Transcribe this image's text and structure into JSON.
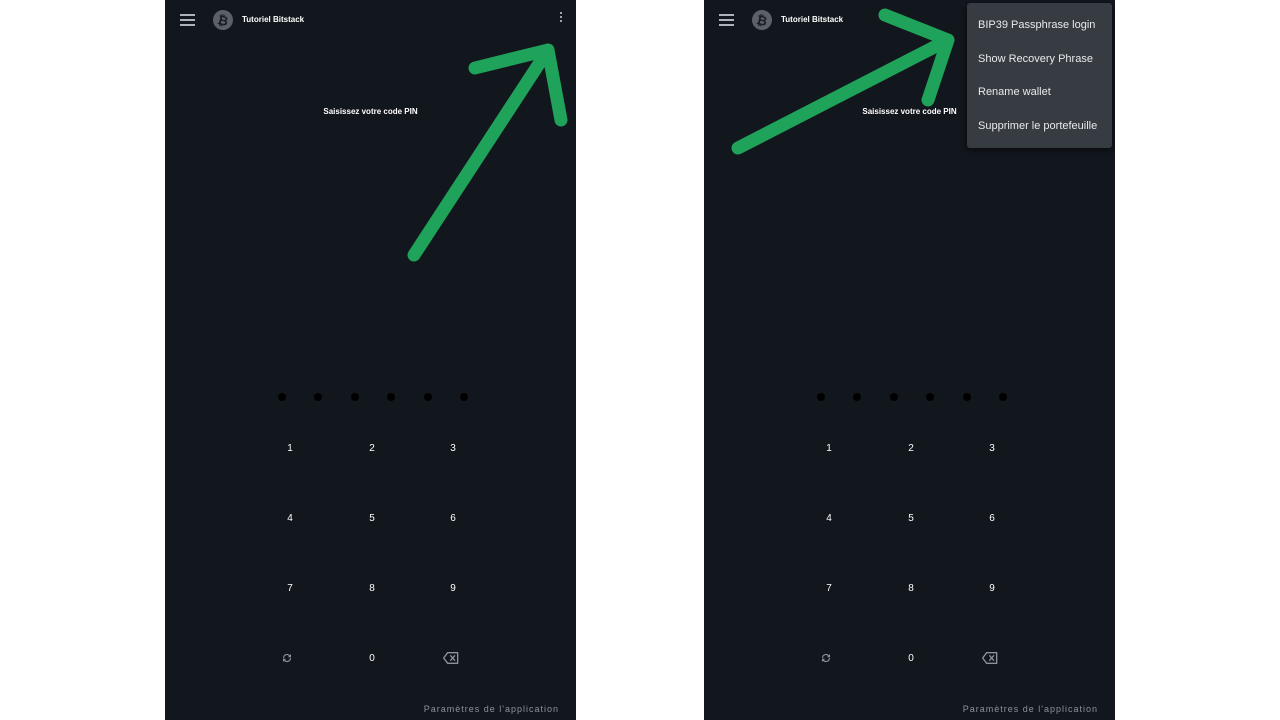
{
  "screens": [
    {
      "wallet_name": "Tutoriel Bitstack",
      "pin_prompt": "Saisissez votre code PIN",
      "keypad": [
        "1",
        "2",
        "3",
        "4",
        "5",
        "6",
        "7",
        "8",
        "9",
        "0"
      ],
      "footer": "Paramètres de l'application"
    },
    {
      "wallet_name": "Tutoriel Bitstack",
      "pin_prompt": "Saisissez votre code PIN",
      "keypad": [
        "1",
        "2",
        "3",
        "4",
        "5",
        "6",
        "7",
        "8",
        "9",
        "0"
      ],
      "footer": "Paramètres de l'application",
      "menu": [
        "BIP39 Passphrase login",
        "Show Recovery Phrase",
        "Rename wallet",
        "Supprimer le portefeuille"
      ]
    }
  ],
  "colors": {
    "background": "#12161d",
    "menu": "#373c43",
    "annotation_arrow": "#1fa35a"
  },
  "icons": [
    "menu-icon",
    "bitcoin-logo-icon",
    "more-vert-icon",
    "refresh-icon",
    "backspace-icon"
  ]
}
